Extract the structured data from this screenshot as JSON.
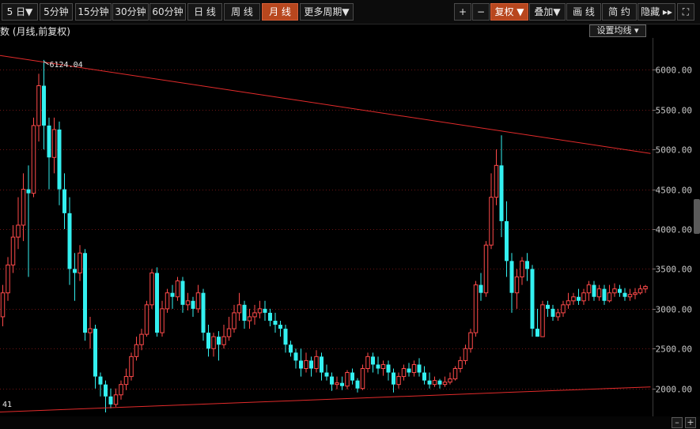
{
  "toolbar": {
    "periods": [
      {
        "label": "5 日▼",
        "active": false
      },
      {
        "label": "5分钟",
        "active": false
      },
      {
        "label": "15分钟",
        "active": false
      },
      {
        "label": "30分钟",
        "active": false
      },
      {
        "label": "60分钟",
        "active": false
      },
      {
        "label": "日 线",
        "active": false
      },
      {
        "label": "周 线",
        "active": false
      },
      {
        "label": "月 线",
        "active": true
      },
      {
        "label": "更多周期▼",
        "active": false
      }
    ],
    "right_buttons": [
      {
        "label": "+",
        "active": false
      },
      {
        "label": "−",
        "active": false
      },
      {
        "label": "复权 ▼",
        "active": true
      },
      {
        "label": "叠加▼",
        "active": false
      },
      {
        "label": "画 线",
        "active": false
      },
      {
        "label": "简 约",
        "active": false
      },
      {
        "label": "隐藏 ▸▸",
        "active": false
      },
      {
        "label": "⛶",
        "active": false
      }
    ]
  },
  "indicator_title": "数 (月线,前复权)",
  "ma_settings_label": "设置均线 ▾",
  "colors": {
    "up": "#ff4a4a",
    "down": "#33f0f0",
    "trendline": "#e32b2b",
    "grid": "#6e1515",
    "axis_text": "#c8c8c8"
  },
  "chart_data": {
    "type": "candlestick",
    "timeframe": "monthly",
    "price_adjustment": "前复权",
    "y_axis": {
      "min": 1650,
      "max": 6400,
      "ticks": [
        6000,
        5500,
        5000,
        4500,
        4000,
        3500,
        3000,
        2500,
        2000
      ],
      "tick_labels": [
        "6000.00",
        "5500.00",
        "5000.00",
        "4500.00",
        "4000.00",
        "3500.00",
        "3000.00",
        "2500.00",
        "2000.00"
      ]
    },
    "annotations": [
      {
        "text": "6124.04",
        "value": 6124.04,
        "bar_index": 8
      },
      {
        "text": "41",
        "value": 1741,
        "bar_index": 0
      }
    ],
    "trendlines": [
      {
        "name": "upper",
        "from": {
          "bar": 0,
          "value": 6180
        },
        "to": {
          "bar": 126,
          "value": 4950
        }
      },
      {
        "name": "lower",
        "from": {
          "bar": 0,
          "value": 1705
        },
        "to": {
          "bar": 126,
          "value": 2020
        }
      }
    ],
    "bars": [
      [
        2900,
        3200,
        3300,
        2780
      ],
      [
        3200,
        3550,
        3650,
        3100
      ],
      [
        3550,
        3900,
        4050,
        3450
      ],
      [
        3900,
        4050,
        4400,
        3750
      ],
      [
        4050,
        4500,
        4700,
        3850
      ],
      [
        4500,
        4450,
        4800,
        3400
      ],
      [
        4450,
        5300,
        5400,
        4400
      ],
      [
        5300,
        5800,
        5950,
        5100
      ],
      [
        5800,
        5300,
        6124,
        5000
      ],
      [
        5300,
        4900,
        5400,
        4500
      ],
      [
        4900,
        5250,
        5400,
        4700
      ],
      [
        5250,
        4500,
        5350,
        4300
      ],
      [
        4500,
        4200,
        4700,
        4000
      ],
      [
        4200,
        3500,
        4400,
        3300
      ],
      [
        3500,
        3450,
        3700,
        3100
      ],
      [
        3450,
        3700,
        3800,
        3350
      ],
      [
        3700,
        2700,
        3750,
        2600
      ],
      [
        2700,
        2750,
        2900,
        2500
      ],
      [
        2750,
        2150,
        2800,
        2000
      ],
      [
        2150,
        2050,
        2200,
        1900
      ],
      [
        2050,
        1900,
        2100,
        1700
      ],
      [
        1900,
        1800,
        2000,
        1750
      ],
      [
        1800,
        1920,
        2000,
        1770
      ],
      [
        1920,
        2050,
        2100,
        1860
      ],
      [
        2050,
        2150,
        2250,
        1980
      ],
      [
        2150,
        2400,
        2450,
        2100
      ],
      [
        2400,
        2550,
        2650,
        2350
      ],
      [
        2550,
        2680,
        2750,
        2480
      ],
      [
        2680,
        3050,
        3100,
        2650
      ],
      [
        3050,
        3450,
        3500,
        3000
      ],
      [
        3450,
        2700,
        3520,
        2650
      ],
      [
        2700,
        3000,
        3100,
        2650
      ],
      [
        3000,
        3200,
        3250,
        2950
      ],
      [
        3200,
        3150,
        3300,
        3000
      ],
      [
        3150,
        3350,
        3400,
        3100
      ],
      [
        3350,
        3050,
        3400,
        2950
      ],
      [
        3050,
        3100,
        3200,
        2980
      ],
      [
        3100,
        3000,
        3150,
        2900
      ],
      [
        3000,
        3200,
        3300,
        2950
      ],
      [
        3200,
        2700,
        3250,
        2600
      ],
      [
        2700,
        2500,
        2800,
        2400
      ],
      [
        2500,
        2650,
        2700,
        2400
      ],
      [
        2650,
        2550,
        2720,
        2350
      ],
      [
        2550,
        2650,
        2800,
        2500
      ],
      [
        2650,
        2750,
        2900,
        2600
      ],
      [
        2750,
        2950,
        3050,
        2700
      ],
      [
        2950,
        3050,
        3200,
        2850
      ],
      [
        3050,
        2850,
        3100,
        2750
      ],
      [
        2850,
        2900,
        3000,
        2750
      ],
      [
        2900,
        2950,
        3050,
        2800
      ],
      [
        2950,
        3000,
        3100,
        2880
      ],
      [
        3000,
        2950,
        3100,
        2850
      ],
      [
        2950,
        2850,
        3000,
        2780
      ],
      [
        2850,
        2800,
        2950,
        2700
      ],
      [
        2800,
        2750,
        2850,
        2650
      ],
      [
        2750,
        2550,
        2800,
        2450
      ],
      [
        2550,
        2450,
        2600,
        2400
      ],
      [
        2450,
        2350,
        2500,
        2250
      ],
      [
        2350,
        2250,
        2500,
        2150
      ],
      [
        2250,
        2350,
        2450,
        2200
      ],
      [
        2350,
        2250,
        2400,
        2150
      ],
      [
        2250,
        2400,
        2480,
        2200
      ],
      [
        2400,
        2200,
        2450,
        2100
      ],
      [
        2200,
        2150,
        2300,
        2100
      ],
      [
        2150,
        2050,
        2200,
        1970
      ],
      [
        2050,
        2070,
        2150,
        1990
      ],
      [
        2070,
        2030,
        2150,
        1980
      ],
      [
        2030,
        2200,
        2230,
        1990
      ],
      [
        2200,
        2100,
        2250,
        2050
      ],
      [
        2100,
        2000,
        2130,
        1950
      ],
      [
        2000,
        2250,
        2300,
        1980
      ],
      [
        2250,
        2400,
        2450,
        2200
      ],
      [
        2400,
        2300,
        2450,
        2200
      ],
      [
        2300,
        2250,
        2400,
        2180
      ],
      [
        2250,
        2300,
        2350,
        2160
      ],
      [
        2300,
        2200,
        2350,
        2100
      ],
      [
        2200,
        2050,
        2250,
        1950
      ],
      [
        2050,
        2150,
        2200,
        2000
      ],
      [
        2150,
        2250,
        2300,
        2100
      ],
      [
        2250,
        2200,
        2320,
        2150
      ],
      [
        2200,
        2300,
        2350,
        2150
      ],
      [
        2300,
        2200,
        2380,
        2150
      ],
      [
        2200,
        2100,
        2280,
        2050
      ],
      [
        2100,
        2050,
        2200,
        2000
      ],
      [
        2050,
        2100,
        2150,
        2020
      ],
      [
        2100,
        2050,
        2120,
        2000
      ],
      [
        2050,
        2080,
        2150,
        2020
      ],
      [
        2080,
        2120,
        2200,
        2050
      ],
      [
        2120,
        2250,
        2280,
        2100
      ],
      [
        2250,
        2350,
        2400,
        2200
      ],
      [
        2350,
        2500,
        2550,
        2300
      ],
      [
        2500,
        2700,
        2750,
        2450
      ],
      [
        2700,
        3300,
        3350,
        2650
      ],
      [
        3300,
        3200,
        3450,
        3100
      ],
      [
        3200,
        3800,
        3850,
        3150
      ],
      [
        3800,
        4400,
        4700,
        3750
      ],
      [
        4400,
        4800,
        5000,
        4300
      ],
      [
        4800,
        4100,
        5178,
        3900
      ],
      [
        4100,
        3600,
        4350,
        3400
      ],
      [
        3600,
        3200,
        3700,
        2950
      ],
      [
        3200,
        3400,
        3500,
        3000
      ],
      [
        3400,
        3600,
        3650,
        3300
      ],
      [
        3600,
        3500,
        3700,
        3350
      ],
      [
        3500,
        2750,
        3550,
        2650
      ],
      [
        2750,
        2650,
        3000,
        2650
      ],
      [
        2650,
        3050,
        3100,
        2650
      ],
      [
        3050,
        3000,
        3100,
        2900
      ],
      [
        3000,
        2900,
        3050,
        2850
      ],
      [
        2900,
        2950,
        3000,
        2850
      ],
      [
        2950,
        3050,
        3100,
        2900
      ],
      [
        3050,
        3100,
        3200,
        3000
      ],
      [
        3100,
        3150,
        3200,
        3050
      ],
      [
        3150,
        3100,
        3250,
        3050
      ],
      [
        3100,
        3200,
        3250,
        3050
      ],
      [
        3200,
        3300,
        3350,
        3100
      ],
      [
        3300,
        3150,
        3350,
        3100
      ],
      [
        3150,
        3250,
        3300,
        3100
      ],
      [
        3250,
        3100,
        3300,
        3050
      ],
      [
        3100,
        3200,
        3300,
        3080
      ],
      [
        3200,
        3250,
        3320,
        3150
      ],
      [
        3250,
        3200,
        3300,
        3150
      ],
      [
        3200,
        3150,
        3260,
        3100
      ],
      [
        3150,
        3180,
        3250,
        3100
      ],
      [
        3180,
        3200,
        3260,
        3120
      ],
      [
        3200,
        3250,
        3300,
        3180
      ],
      [
        3250,
        3280,
        3300,
        3200
      ]
    ]
  }
}
